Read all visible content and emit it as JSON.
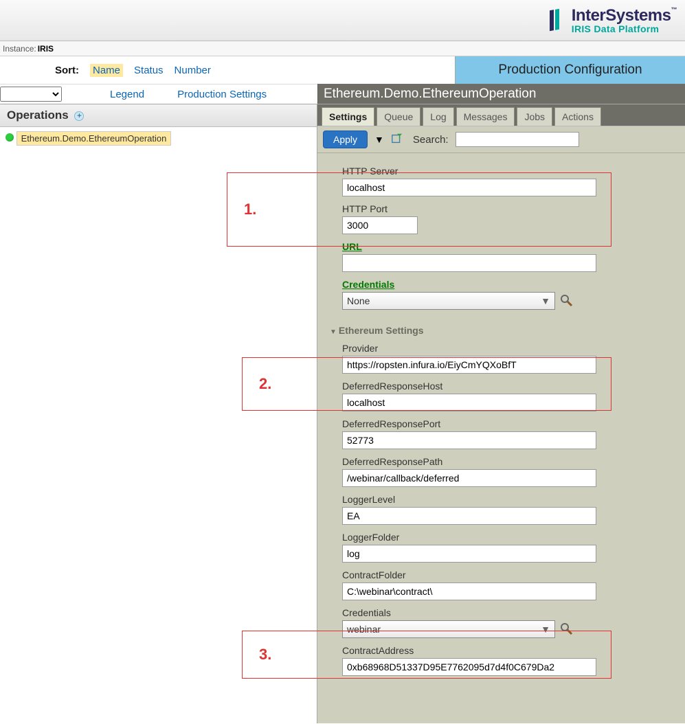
{
  "brand": {
    "line1": "InterSystems",
    "tm": "™",
    "line2": "IRIS Data Platform"
  },
  "instance": {
    "label": "Instance:",
    "name": "IRIS"
  },
  "sort": {
    "label": "Sort:",
    "options": [
      {
        "key": "name",
        "label": "Name",
        "active": true
      },
      {
        "key": "status",
        "label": "Status",
        "active": false
      },
      {
        "key": "number",
        "label": "Number",
        "active": false
      }
    ]
  },
  "page_title": "Production Configuration",
  "row2": {
    "legend": "Legend",
    "prod_settings": "Production Settings"
  },
  "settings_title": "Ethereum.Demo.EthereumOperation",
  "operations": {
    "header": "Operations",
    "items": [
      {
        "label": "Ethereum.Demo.EthereumOperation",
        "status": "running"
      }
    ]
  },
  "tabs": [
    {
      "label": "Settings",
      "active": true
    },
    {
      "label": "Queue",
      "active": false
    },
    {
      "label": "Log",
      "active": false
    },
    {
      "label": "Messages",
      "active": false
    },
    {
      "label": "Jobs",
      "active": false
    },
    {
      "label": "Actions",
      "active": false
    }
  ],
  "toolbar": {
    "apply": "Apply",
    "search_label": "Search:",
    "search_value": ""
  },
  "annotations": [
    "1.",
    "2.",
    "3."
  ],
  "settings": {
    "http_server": {
      "label": "HTTP Server",
      "value": "localhost"
    },
    "http_port": {
      "label": "HTTP Port",
      "value": "3000"
    },
    "url": {
      "label": "URL",
      "value": ""
    },
    "credentials_top": {
      "label": "Credentials",
      "value": "None"
    },
    "section_ethereum": "Ethereum Settings",
    "provider": {
      "label": "Provider",
      "value": "https://ropsten.infura.io/EiyCmYQXoBfT"
    },
    "deferred_host": {
      "label": "DeferredResponseHost",
      "value": "localhost"
    },
    "deferred_port": {
      "label": "DeferredResponsePort",
      "value": "52773"
    },
    "deferred_path": {
      "label": "DeferredResponsePath",
      "value": "/webinar/callback/deferred"
    },
    "logger_level": {
      "label": "LoggerLevel",
      "value": "EA"
    },
    "logger_folder": {
      "label": "LoggerFolder",
      "value": "log"
    },
    "contract_folder": {
      "label": "ContractFolder",
      "value": "C:\\webinar\\contract\\"
    },
    "credentials_eth": {
      "label": "Credentials",
      "value": "webinar"
    },
    "contract_address": {
      "label": "ContractAddress",
      "value": "0xb68968D51337D95E7762095d7d4f0C679Da2"
    }
  }
}
